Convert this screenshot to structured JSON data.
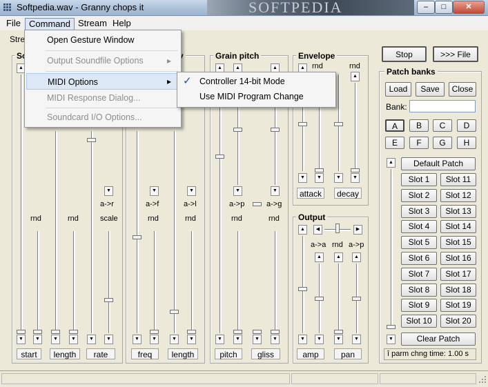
{
  "window": {
    "title": "Softpedia.wav - Granny chops it",
    "watermark": "SOFTPEDIA"
  },
  "menubar": {
    "file": "File",
    "command": "Command",
    "stream": "Stream",
    "help": "Help"
  },
  "command_menu": {
    "items": [
      "Open Gesture Window",
      "Output Soundfile Options",
      "MIDI Options",
      "MIDI Response Dialog...",
      "Soundcard I/O Options..."
    ]
  },
  "midi_submenu": {
    "controller_14bit": "Controller 14-bit Mode",
    "use_program_change": "Use MIDI Program Change",
    "checkmark": "✓"
  },
  "groups": {
    "stream_tab": "Stre",
    "sound_partial": "So",
    "freq_partial": "y",
    "grain_pitch": "Grain pitch",
    "envelope": "Envelope",
    "output": "Output"
  },
  "labels": {
    "rnd": "rnd",
    "scale": "scale",
    "a_to_r": "a->r",
    "a_to_f": "a->f",
    "a_to_l": "a->l",
    "a_to_p": "a->p",
    "a_to_g": "a->g",
    "a_to_a": "a->a",
    "start": "start",
    "length": "length",
    "rate": "rate",
    "freq": "freq",
    "pitch": "pitch",
    "gliss": "gliss",
    "attack": "attack",
    "decay": "decay",
    "amp": "amp",
    "pan": "pan"
  },
  "controls": {
    "stop": "Stop",
    "to_file": ">>> File"
  },
  "patch_banks": {
    "title": "Patch banks",
    "load": "Load",
    "save": "Save",
    "close": "Close",
    "bank_label": "Bank:",
    "bank_value": "",
    "banks": [
      "A",
      "B",
      "C",
      "D",
      "E",
      "F",
      "G",
      "H"
    ],
    "default_patch": "Default Patch",
    "slots": [
      "Slot 1",
      "Slot 11",
      "Slot 2",
      "Slot 12",
      "Slot 3",
      "Slot 13",
      "Slot 4",
      "Slot 14",
      "Slot 5",
      "Slot 15",
      "Slot 6",
      "Slot 16",
      "Slot 7",
      "Slot 17",
      "Slot 8",
      "Slot 18",
      "Slot 9",
      "Slot 19",
      "Slot 10",
      "Slot 20"
    ],
    "clear_patch": "Clear Patch",
    "parm_change": "î  parm chng time: 1.00 s"
  },
  "icons": {
    "up": "▲",
    "down": "▼",
    "left": "◀",
    "right": "▶",
    "submenu": "▸"
  }
}
